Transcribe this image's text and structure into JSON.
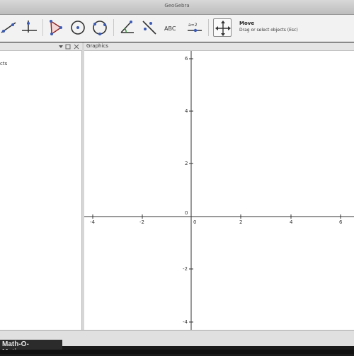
{
  "window": {
    "title": "GeoGebra"
  },
  "toolbar": {
    "tools": [
      {
        "name": "line-tool",
        "label": "Line"
      },
      {
        "name": "perpendicular-line-tool",
        "label": "Perpendicular Line"
      },
      {
        "name": "polygon-tool",
        "label": "Polygon"
      },
      {
        "name": "circle-tool",
        "label": "Circle with Center through Point"
      },
      {
        "name": "circle-three-points-tool",
        "label": "Circle through 3 Points"
      },
      {
        "name": "angle-tool",
        "label": "Angle"
      },
      {
        "name": "reflect-tool",
        "label": "Reflect about Line"
      },
      {
        "name": "text-tool",
        "label": "ABC"
      },
      {
        "name": "slider-tool",
        "label": "a=2"
      },
      {
        "name": "move-graphics-tool",
        "label": "Move Graphics View"
      }
    ],
    "active_tool": {
      "name": "Move",
      "help": "Drag or select objects (Esc)"
    }
  },
  "algebra": {
    "item": "cts"
  },
  "graphics": {
    "title": "Graphics",
    "x_ticks": [
      "-4",
      "-2",
      "0",
      "2",
      "4",
      "6"
    ],
    "y_ticks": [
      "6",
      "4",
      "2",
      "0",
      "-2",
      "-4"
    ]
  },
  "watermark": {
    "text": "Math-O-Matic.com"
  }
}
